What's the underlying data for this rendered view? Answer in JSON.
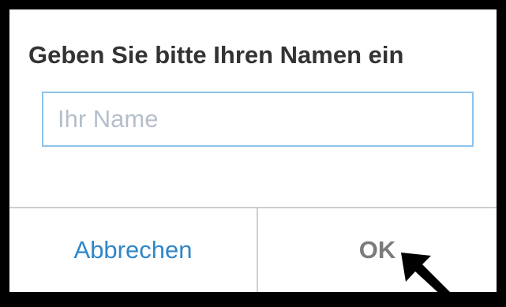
{
  "dialog": {
    "title": "Geben Sie bitte Ihren Namen ein",
    "name_input": {
      "value": "",
      "placeholder": "Ihr Name"
    },
    "buttons": {
      "cancel_label": "Abbrechen",
      "ok_label": "OK"
    }
  },
  "annotation": {
    "icon": "pointer-arrow-icon",
    "target": "ok-button"
  },
  "colors": {
    "border": "#000000",
    "background": "#ffffff",
    "title": "#333333",
    "input_border": "#8fc3ea",
    "placeholder": "#b5bfcb",
    "cancel_text": "#2f86c9",
    "ok_text": "#7b7b7b",
    "divider": "#cfcfcf"
  }
}
